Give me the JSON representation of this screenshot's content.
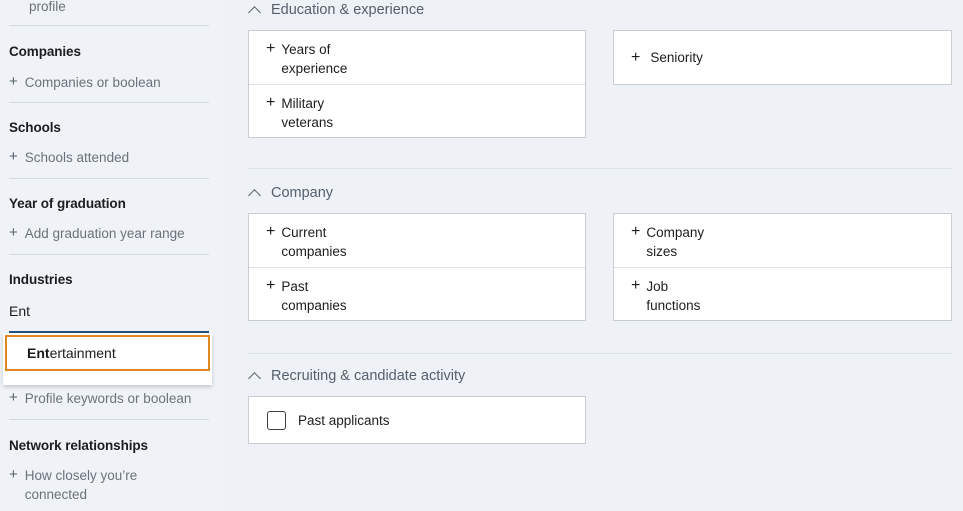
{
  "sidebar": {
    "partial_item_text": "profile",
    "sections": [
      {
        "heading": "Companies",
        "add_label": "Companies or boolean"
      },
      {
        "heading": "Schools",
        "add_label": "Schools attended"
      },
      {
        "heading": "Year of graduation",
        "add_label": "Add graduation year range"
      },
      {
        "heading": "Industries",
        "add_label": ""
      },
      {
        "heading": "",
        "add_label": "Profile keywords or boolean"
      },
      {
        "heading": "Network relationships",
        "add_label": "How closely you’re connected"
      }
    ],
    "plus_icon": "plus-icon",
    "industries": {
      "input_value": "Ent",
      "input_placeholder": "Industries",
      "focus_underline_color": "#23527c",
      "typeahead": {
        "options": [
          {
            "matched": "Ent",
            "rest": "ertainment",
            "full": "Entertainment",
            "highlighted": true
          }
        ],
        "highlight_border_color": "#e08622"
      }
    }
  },
  "main": {
    "sections": [
      {
        "title": "Education & experience",
        "collapse_icon": "chevron-up-icon",
        "left_card": [
          {
            "label_line1": "Years of",
            "label_line2": "experience",
            "icon": "plus-icon"
          },
          {
            "label_line1": "Military",
            "label_line2": "veterans",
            "icon": "plus-icon"
          }
        ],
        "right_card": [
          {
            "label_line1": "Seniority",
            "label_line2": "",
            "icon": "plus-icon"
          }
        ]
      },
      {
        "title": "Company",
        "collapse_icon": "chevron-up-icon",
        "left_card": [
          {
            "label_line1": "Current",
            "label_line2": "companies",
            "icon": "plus-icon"
          },
          {
            "label_line1": "Past",
            "label_line2": "companies",
            "icon": "plus-icon"
          }
        ],
        "right_card": [
          {
            "label_line1": "Company",
            "label_line2": "sizes",
            "icon": "plus-icon"
          },
          {
            "label_line1": "Job",
            "label_line2": "functions",
            "icon": "plus-icon"
          }
        ]
      },
      {
        "title": "Recruiting & candidate activity",
        "collapse_icon": "chevron-up-icon",
        "checkbox_rows": [
          {
            "label": "Past applicants",
            "checked": false
          }
        ]
      }
    ]
  },
  "colors": {
    "page_background": "#eef2f7",
    "sidebar_background": "#eff3f8",
    "card_background": "#ffffff",
    "card_border": "#c8ced6",
    "divider": "#dde3ea",
    "heading_text": "#1d1d1d",
    "muted_text": "#6b7279",
    "section_title": "#55606b",
    "accent_orange": "#e08622",
    "accent_blue": "#23527c"
  }
}
